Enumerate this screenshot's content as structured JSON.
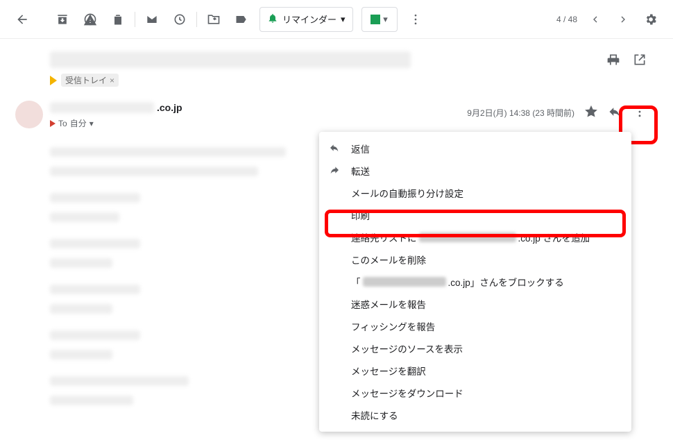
{
  "toolbar": {
    "reminder_label": "リマインダー",
    "page_count": "4 / 48"
  },
  "labels": {
    "inbox": "受信トレイ"
  },
  "sender": {
    "domain_suffix": ".co.jp"
  },
  "recipient": {
    "to_prefix": "To",
    "to_self": "自分"
  },
  "meta": {
    "date": "9月2日(月) 14:38 (23 時間前)"
  },
  "menu": {
    "reply": "返信",
    "forward": "転送",
    "filter": "メールの自動振り分け設定",
    "print": "印刷",
    "add_contact_prefix": "連絡先リストに",
    "add_contact_suffix": ".co.jp さんを追加",
    "delete": "このメールを削除",
    "block_prefix": "「",
    "block_suffix": ".co.jp」さんをブロックする",
    "report_spam": "迷惑メールを報告",
    "report_phishing": "フィッシングを報告",
    "show_original": "メッセージのソースを表示",
    "translate": "メッセージを翻訳",
    "download": "メッセージをダウンロード",
    "mark_unread": "未読にする"
  }
}
